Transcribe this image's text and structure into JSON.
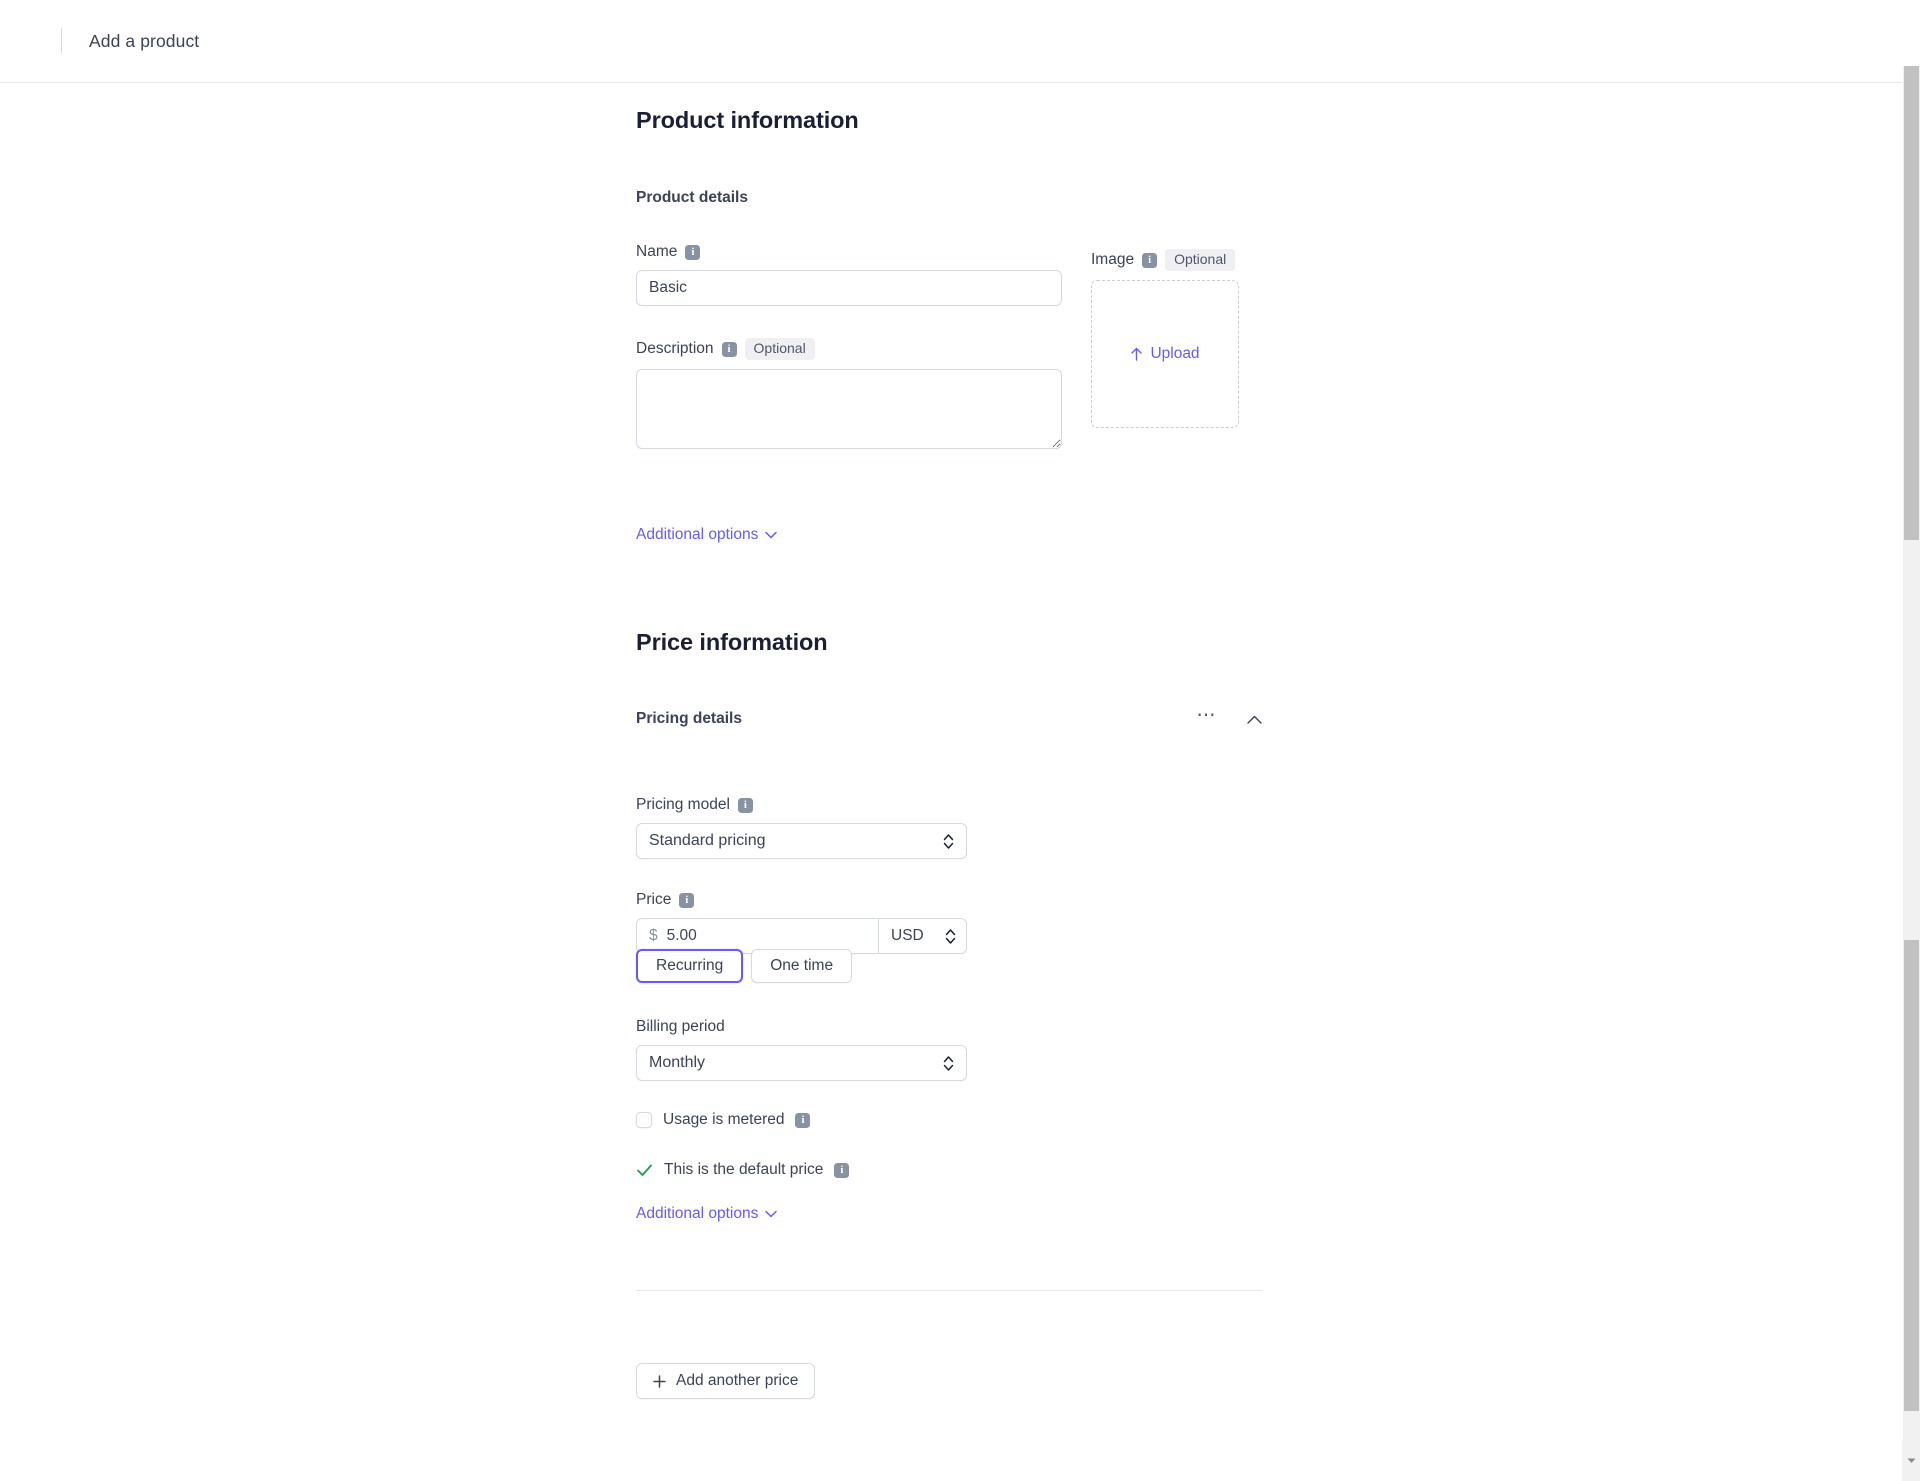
{
  "header": {
    "title": "Add a product"
  },
  "product_section": {
    "heading": "Product information",
    "subheading": "Product details",
    "name": {
      "label": "Name",
      "info_icon": "info-icon",
      "value": "Basic"
    },
    "description": {
      "label": "Description",
      "info_icon": "info-icon",
      "badge": "Optional",
      "value": ""
    },
    "image": {
      "label": "Image",
      "info_icon": "info-icon",
      "badge": "Optional",
      "upload_label": "Upload",
      "upload_icon": "upload-arrow-icon"
    },
    "additional_options": {
      "label": "Additional options",
      "icon": "chevron-down-icon"
    }
  },
  "price_section": {
    "heading": "Price information",
    "subheading": "Pricing details",
    "more_icon": "ellipsis-icon",
    "collapse_icon": "chevron-up-icon",
    "pricing_model": {
      "label": "Pricing model",
      "info_icon": "info-icon",
      "value": "Standard pricing",
      "options": [
        "Standard pricing"
      ]
    },
    "price": {
      "label": "Price",
      "info_icon": "info-icon",
      "currency_symbol": "$",
      "amount": "5.00",
      "currency": "USD",
      "currency_options": [
        "USD"
      ]
    },
    "billing_type": {
      "recurring_label": "Recurring",
      "one_time_label": "One time",
      "selected": "Recurring"
    },
    "billing_period": {
      "label": "Billing period",
      "value": "Monthly",
      "options": [
        "Monthly"
      ]
    },
    "usage_metered": {
      "label": "Usage is metered",
      "info_icon": "info-icon",
      "checked": false
    },
    "default_price": {
      "label": "This is the default price",
      "info_icon": "info-icon",
      "check_icon": "green-check-icon"
    },
    "additional_options": {
      "label": "Additional options",
      "icon": "chevron-down-icon"
    },
    "add_another_price": {
      "label": "Add another price",
      "icon": "plus-icon"
    }
  },
  "colors": {
    "accent": "#635bff",
    "text": "#3c4257",
    "heading": "#1a1f36",
    "success": "#1a9f47",
    "info_badge": "#8792a2"
  },
  "icons": {
    "info": "i"
  }
}
